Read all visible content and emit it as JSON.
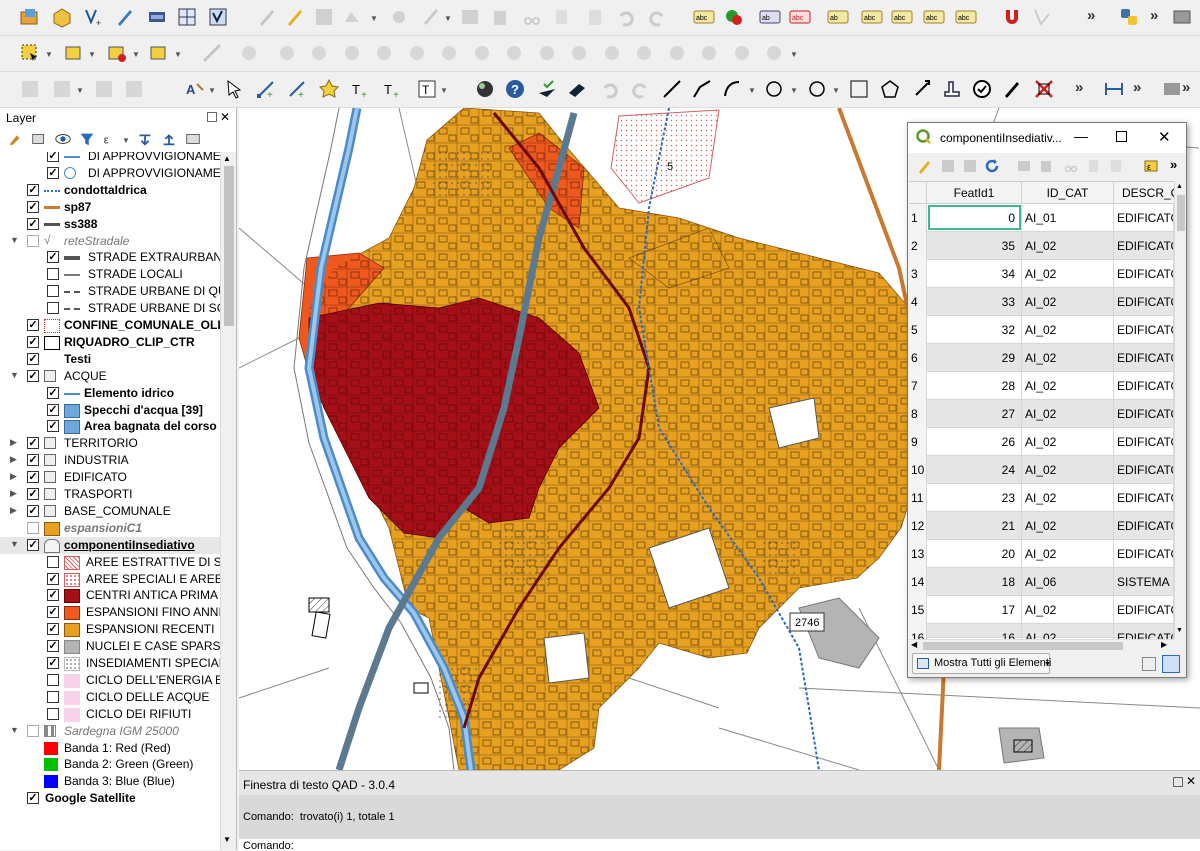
{
  "layers_panel": {
    "title": "Layer",
    "items": [
      {
        "label": "DI APPROVVIGIONAMENTO",
        "style": "normal"
      },
      {
        "label": "DI APPROVVIGIONAMENTO",
        "style": "normal"
      },
      {
        "label": "condottaIdrica",
        "style": "bold"
      },
      {
        "label": "sp87",
        "style": "bold"
      },
      {
        "label": "ss388",
        "style": "bold"
      },
      {
        "label": "reteStradale",
        "style": "italic"
      },
      {
        "label": "STRADE EXTRAURBANE PR",
        "style": "normal"
      },
      {
        "label": "STRADE LOCALI",
        "style": "normal"
      },
      {
        "label": "STRADE URBANE DI QUART",
        "style": "normal"
      },
      {
        "label": "STRADE URBANE DI SCORR",
        "style": "normal"
      },
      {
        "label": "CONFINE_COMUNALE_OLLAST",
        "style": "bold"
      },
      {
        "label": "RIQUADRO_CLIP_CTR",
        "style": "bold"
      },
      {
        "label": "Testi",
        "style": "bold"
      },
      {
        "label": "ACQUE",
        "style": "normal"
      },
      {
        "label": "Elemento idrico",
        "style": "bold"
      },
      {
        "label": "Specchi d'acqua [39]",
        "style": "bold"
      },
      {
        "label": "Area bagnata del corso d'a",
        "style": "bold"
      },
      {
        "label": "TERRITORIO",
        "style": "normal"
      },
      {
        "label": "INDUSTRIA",
        "style": "normal"
      },
      {
        "label": "EDIFICATO",
        "style": "normal"
      },
      {
        "label": "TRASPORTI",
        "style": "normal"
      },
      {
        "label": "BASE_COMUNALE",
        "style": "normal"
      },
      {
        "label": "espansioniC1",
        "style": "italic"
      },
      {
        "label": "componentiInsediativo",
        "style": "bold-underline"
      },
      {
        "label": "AREE ESTRATTIVE DI SECON",
        "style": "normal"
      },
      {
        "label": "AREE SPECIALI E AREE MILI",
        "style": "normal"
      },
      {
        "label": "CENTRI ANTICA PRIMA FO",
        "style": "normal"
      },
      {
        "label": "ESPANSIONI FINO ANNI 50",
        "style": "normal"
      },
      {
        "label": "ESPANSIONI RECENTI",
        "style": "normal"
      },
      {
        "label": "NUCLEI E CASE SPARSE",
        "style": "normal"
      },
      {
        "label": "INSEDIAMENTI SPECIALIZZ",
        "style": "normal"
      },
      {
        "label": "CICLO DELL'ENERGIA ELET",
        "style": "normal"
      },
      {
        "label": "CICLO DELLE ACQUE",
        "style": "normal"
      },
      {
        "label": "CICLO DEI RIFIUTI",
        "style": "normal"
      },
      {
        "label": "Sardegna IGM 25000",
        "style": "italic"
      },
      {
        "label": "Banda 1: Red (Red)",
        "style": "normal"
      },
      {
        "label": "Banda 2: Green (Green)",
        "style": "normal"
      },
      {
        "label": "Banda 3: Blue (Blue)",
        "style": "normal"
      },
      {
        "label": "Google Satellite",
        "style": "bold"
      }
    ]
  },
  "map": {
    "label_5": "5",
    "label_2746": "2746"
  },
  "attribute_table": {
    "title": "componentiInsediativ...",
    "columns": [
      "FeatId1",
      "ID_CAT",
      "DESCR_C"
    ],
    "rows": [
      {
        "n": "1",
        "featid": "0",
        "idcat": "AI_01",
        "descr": "EDIFICATO"
      },
      {
        "n": "2",
        "featid": "35",
        "idcat": "AI_02",
        "descr": "EDIFICATO"
      },
      {
        "n": "3",
        "featid": "34",
        "idcat": "AI_02",
        "descr": "EDIFICATO"
      },
      {
        "n": "4",
        "featid": "33",
        "idcat": "AI_02",
        "descr": "EDIFICATO"
      },
      {
        "n": "5",
        "featid": "32",
        "idcat": "AI_02",
        "descr": "EDIFICATO"
      },
      {
        "n": "6",
        "featid": "29",
        "idcat": "AI_02",
        "descr": "EDIFICATO"
      },
      {
        "n": "7",
        "featid": "28",
        "idcat": "AI_02",
        "descr": "EDIFICATO"
      },
      {
        "n": "8",
        "featid": "27",
        "idcat": "AI_02",
        "descr": "EDIFICATO"
      },
      {
        "n": "9",
        "featid": "26",
        "idcat": "AI_02",
        "descr": "EDIFICATO"
      },
      {
        "n": "10",
        "featid": "24",
        "idcat": "AI_02",
        "descr": "EDIFICATO"
      },
      {
        "n": "11",
        "featid": "23",
        "idcat": "AI_02",
        "descr": "EDIFICATO"
      },
      {
        "n": "12",
        "featid": "21",
        "idcat": "AI_02",
        "descr": "EDIFICATO"
      },
      {
        "n": "13",
        "featid": "20",
        "idcat": "AI_02",
        "descr": "EDIFICATO"
      },
      {
        "n": "14",
        "featid": "18",
        "idcat": "AI_06",
        "descr": "SISTEMA DI"
      },
      {
        "n": "15",
        "featid": "17",
        "idcat": "AI_02",
        "descr": "EDIFICATO"
      },
      {
        "n": "16",
        "featid": "16",
        "idcat": "AI_02",
        "descr": "EDIFICATO"
      }
    ],
    "show_all_label": "Mostra Tutti gli Elementi"
  },
  "text_window": {
    "title": "Finestra di testo QAD - 3.0.4",
    "message": "Comando:  trovato(i) 1, totale 1",
    "prompt": "Comando:"
  },
  "colors": {
    "centri_antica": "#a50f15",
    "espansioni_50": "#f0591d",
    "espansioni_recenti": "#e8a021",
    "nuclei": "#b4b4b4",
    "road_blue_grey": "#5b7a90",
    "river": "#4a8cc9"
  }
}
